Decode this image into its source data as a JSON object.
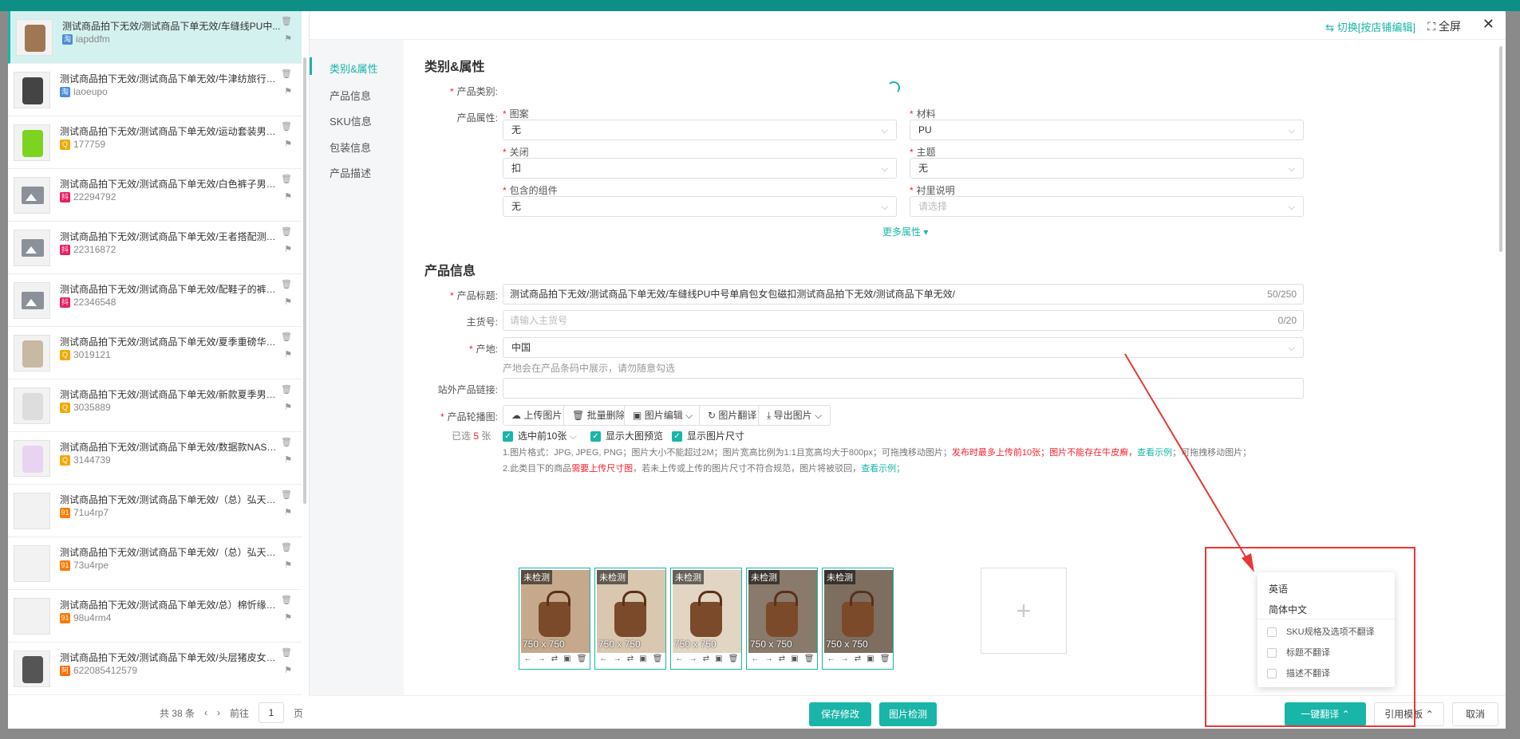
{
  "header": {
    "switch_label": "切换[按店铺编辑]",
    "fullscreen_label": "全屏",
    "close_icon": "close-icon"
  },
  "product_list": {
    "items": [
      {
        "title": "测试商品拍下无效/测试商品下单无效/车缝线PU中...",
        "sub": "iapddfm",
        "badge_color": "#4a8bd6",
        "badge": "淘"
      },
      {
        "title": "测试商品拍下无效/测试商品下单无效/牛津纺旅行袋...",
        "sub": "iaoeupo",
        "badge_color": "#4a8bd6",
        "badge": "淘"
      },
      {
        "title": "测试商品拍下无效/测试商品下单无效/运动套装男夏...",
        "sub": "177759",
        "badge_color": "#f2a900",
        "badge": "Q"
      },
      {
        "title": "测试商品拍下无效/测试商品下单无效/白色裤子男高...",
        "sub": "22294792",
        "badge_color": "#e91e63",
        "badge": "抖"
      },
      {
        "title": "测试商品拍下无效/测试商品下单无效/王者搭配测试...",
        "sub": "22316872",
        "badge_color": "#e91e63",
        "badge": "抖"
      },
      {
        "title": "测试商品拍下无效/测试商品下单无效/配鞋子的裤子...",
        "sub": "22346548",
        "badge_color": "#e91e63",
        "badge": "抖"
      },
      {
        "title": "测试商品拍下无效/测试商品下单无效/夏季重磅华夫...",
        "sub": "3019121",
        "badge_color": "#f2a900",
        "badge": "Q"
      },
      {
        "title": "测试商品拍下无效/测试商品下单无效/新款夏季男士...",
        "sub": "3035889",
        "badge_color": "#f2a900",
        "badge": "Q"
      },
      {
        "title": "测试商品拍下无效/测试商品下单无效/数据款NASA...",
        "sub": "3144739",
        "badge_color": "#f2a900",
        "badge": "Q"
      },
      {
        "title": "测试商品拍下无效/测试商品下单无效/（总）弘天福...",
        "sub": "71u4rp7",
        "badge_color": "#ff7a00",
        "badge": "91"
      },
      {
        "title": "测试商品拍下无效/测试商品下单无效/（总）弘天福...",
        "sub": "73u4rpe",
        "badge_color": "#ff7a00",
        "badge": "91"
      },
      {
        "title": "测试商品拍下无效/测试商品下单无效/总）棉忻缘亲...",
        "sub": "98u4rm4",
        "badge_color": "#ff7a00",
        "badge": "91"
      },
      {
        "title": "测试商品拍下无效/测试商品下单无效/头层猪皮女鞋...",
        "sub": "622085412579",
        "badge_color": "#ff6a00",
        "badge": "阿"
      }
    ],
    "total": "共 38 条",
    "goto": "前往",
    "page": "1",
    "page_unit": "页"
  },
  "side_nav": [
    "类别&属性",
    "产品信息",
    "SKU信息",
    "包装信息",
    "产品描述"
  ],
  "category": {
    "section_title": "类别&属性",
    "category_label": "产品类别:",
    "attr_label": "产品属性:",
    "attrs": [
      {
        "name": "图案",
        "value": "无"
      },
      {
        "name": "材料",
        "value": "PU"
      },
      {
        "name": "关闭",
        "value": "扣"
      },
      {
        "name": "主题",
        "value": "无"
      },
      {
        "name": "包含的组件",
        "value": "无"
      },
      {
        "name": "衬里说明",
        "value": "请选择"
      }
    ],
    "more": "更多属性 ▾"
  },
  "product_info": {
    "section_title": "产品信息",
    "title_label": "产品标题:",
    "title_value": "测试商品拍下无效/测试商品下单无效/车缝线PU中号单肩包女包磁扣测试商品拍下无效/测试商品下单无效/",
    "title_count": "50/250",
    "sku_label": "主货号:",
    "sku_placeholder": "请输入主货号",
    "sku_count": "0/20",
    "origin_label": "产地:",
    "origin_value": "中国",
    "origin_hint": "产地会在产品条码中展示，请勿随意勾选",
    "link_label": "站外产品链接:",
    "carousel_label": "产品轮播图:",
    "toolbar": [
      "上传图片",
      "批量删除",
      "图片编辑",
      "图片翻译",
      "导出图片"
    ],
    "selected_prefix": "已选",
    "selected_count": "5",
    "selected_suffix": "张",
    "opts": [
      "选中前10张",
      "显示大图预览",
      "显示图片尺寸"
    ],
    "rule1_a": "1.图片格式：JPG, JPEG, PNG；图片大小不能超过2M；图片宽高比例为1:1且宽高均大于800px；可拖拽移动图片；",
    "rule1_b": "发布时最多上传前10张；图片不能存在牛皮癣，",
    "rule1_c": "查看示例",
    "rule1_d": "；可拖拽移动图片；",
    "rule2_a": "2.此类目下的商品",
    "rule2_b": "需要上传尺寸图",
    "rule2_c": "，若未上传或上传的图片尺寸不符合规范，图片将被驳回，",
    "rule2_d": "查看示例；",
    "images": [
      {
        "tag": "未检测",
        "size": "750 x 750"
      },
      {
        "tag": "未检测",
        "size": "750 x 750"
      },
      {
        "tag": "未检测",
        "size": "750 x 750"
      },
      {
        "tag": "未检测",
        "size": "750 x 750"
      },
      {
        "tag": "未检测",
        "size": "750 x 750"
      }
    ]
  },
  "footer": {
    "save": "保存修改",
    "check": "图片检测",
    "translate": "一键翻译",
    "template": "引用模板",
    "cancel": "取消"
  },
  "translate_menu": {
    "langs": [
      "英语",
      "简体中文"
    ],
    "options": [
      "SKU规格及选项不翻译",
      "标题不翻译",
      "描述不翻译"
    ]
  }
}
